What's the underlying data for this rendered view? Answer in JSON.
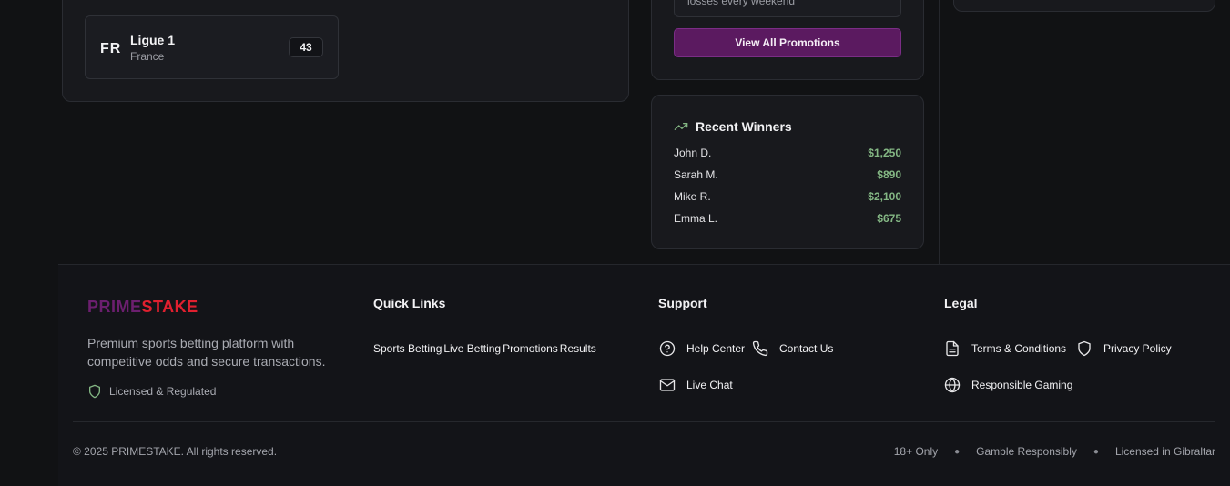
{
  "league": {
    "code": "FR",
    "name": "Ligue 1",
    "country": "France",
    "count": "43"
  },
  "promotions": {
    "item_text": "losses every weekend",
    "view_all_label": "View All Promotions"
  },
  "recent_winners": {
    "title": "Recent Winners",
    "rows": [
      {
        "name": "John D.",
        "amount": "$1,250"
      },
      {
        "name": "Sarah M.",
        "amount": "$890"
      },
      {
        "name": "Mike R.",
        "amount": "$2,100"
      },
      {
        "name": "Emma L.",
        "amount": "$675"
      }
    ]
  },
  "footer": {
    "brand_prime": "PRIME",
    "brand_stake": "STAKE",
    "description": "Premium sports betting platform with competitive odds and secure transactions.",
    "licensed": "Licensed & Regulated",
    "quick_links": {
      "title": "Quick Links",
      "items": [
        "Sports Betting",
        "Live Betting",
        "Promotions",
        "Results"
      ]
    },
    "support": {
      "title": "Support",
      "help_center": "Help Center",
      "contact_us": "Contact Us",
      "live_chat": "Live Chat"
    },
    "legal": {
      "title": "Legal",
      "terms": "Terms & Conditions",
      "privacy": "Privacy Policy",
      "responsible": "Responsible Gaming"
    },
    "copyright": "© 2025 PRIMESTAKE. All rights reserved.",
    "bottom_tags": [
      "18+ Only",
      "Gamble Responsibly",
      "Licensed in Gibraltar"
    ]
  },
  "colors": {
    "accent_purple": "#5b1a60",
    "brand_red": "#e0202f",
    "win_green": "#84b784"
  }
}
